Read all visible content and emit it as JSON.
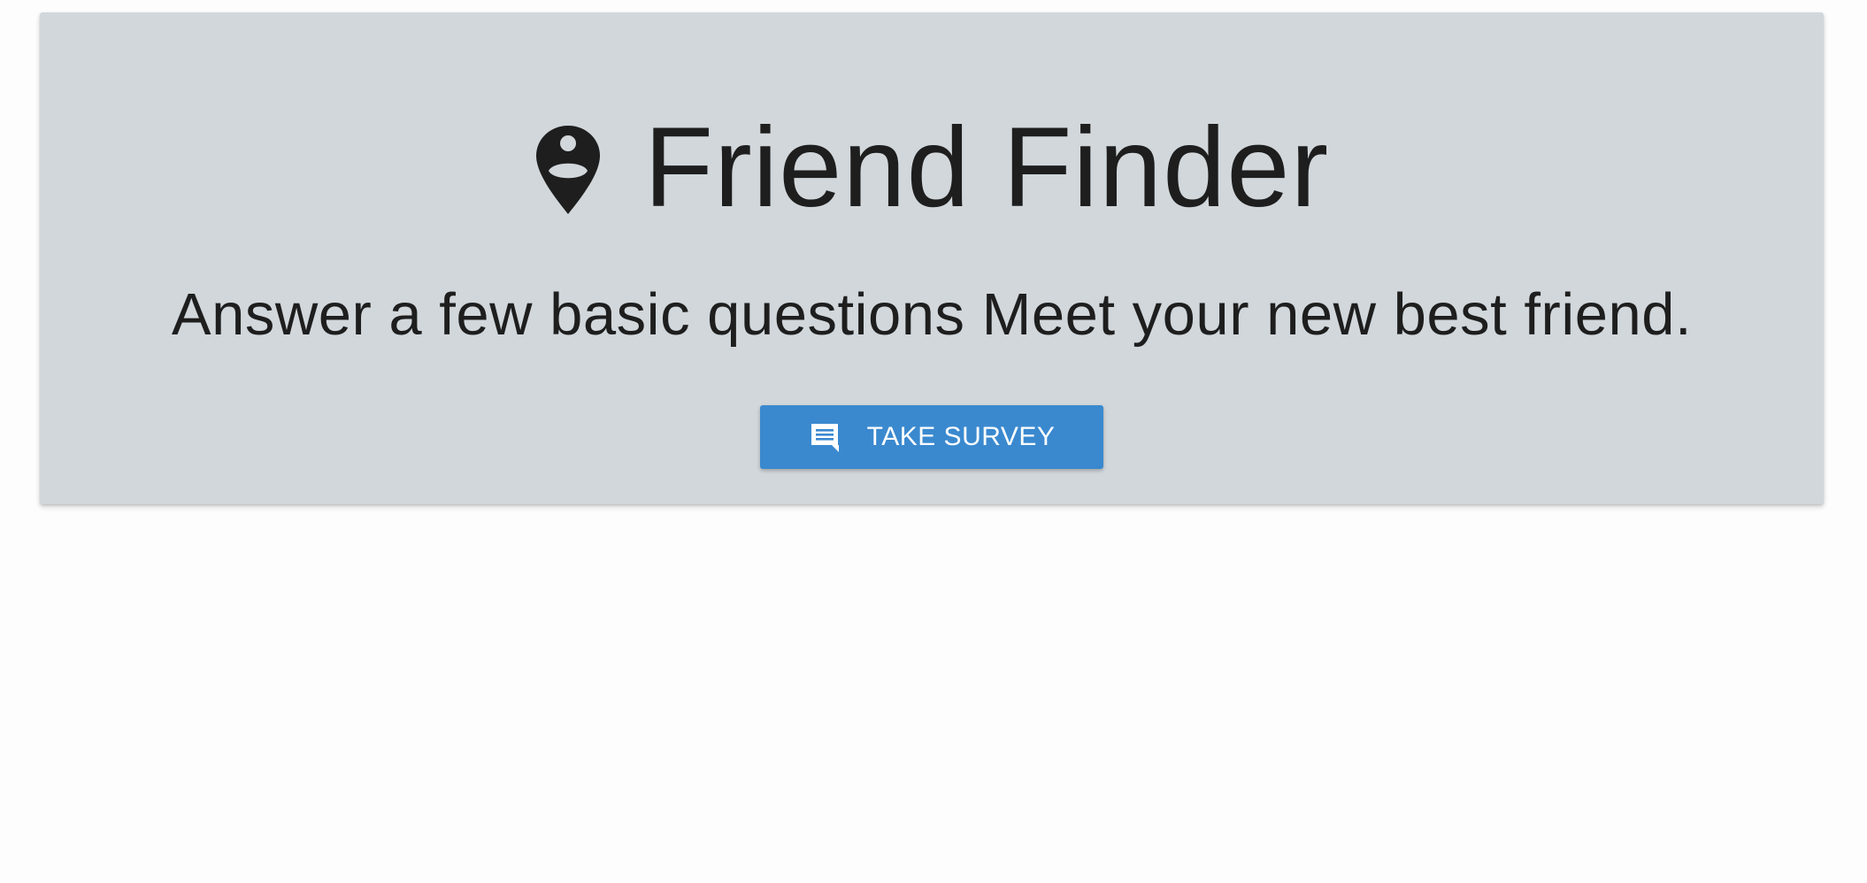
{
  "hero": {
    "icon": "person-pin-icon",
    "title": "Friend Finder",
    "subtitle": "Answer a few basic questions Meet your new best friend."
  },
  "cta": {
    "icon": "chat-bubble-icon",
    "label": "TAKE SURVEY"
  },
  "colors": {
    "hero_background": "#d1d7db",
    "button_background": "#3a89cf",
    "text": "#1e1e1e",
    "page_background": "#fdfdfd"
  }
}
